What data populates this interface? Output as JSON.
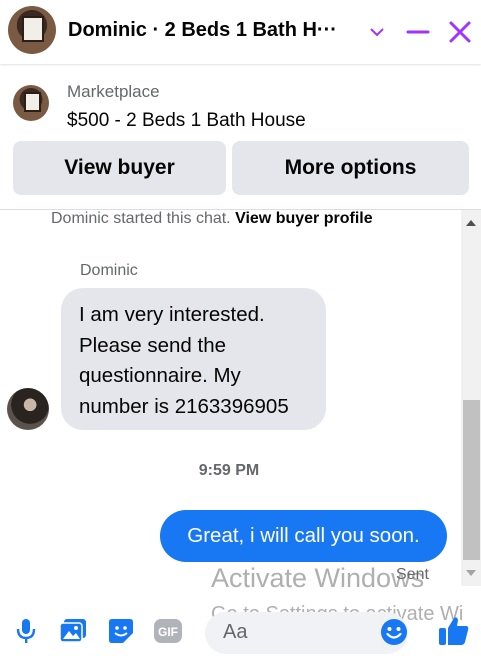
{
  "header": {
    "title": "Dominic · 2 Beds 1 Bath H···",
    "accent_color": "#a033ff",
    "icons": [
      "chevron-down-icon",
      "minimize-icon",
      "close-icon"
    ]
  },
  "marketplace": {
    "label": "Marketplace",
    "listing": "$500 - 2 Beds 1 Bath House"
  },
  "actions": {
    "view_buyer": "View buyer",
    "more_options": "More options"
  },
  "chat": {
    "system_text": "Dominic started this chat.",
    "system_link": "View buyer profile",
    "sender_name": "Dominic",
    "incoming_message": "I am very interested. Please send the questionnaire. My number is 2163396905",
    "timestamp": "9:59 PM",
    "outgoing_message": "Great, i will call you soon.",
    "status": "Sent",
    "bubble_color_in": "#e4e6eb",
    "bubble_color_out": "#1877f2"
  },
  "composer": {
    "placeholder": "Aa",
    "gif_label": "GIF",
    "icons": [
      "microphone-icon",
      "photo-icon",
      "sticker-icon",
      "gif-icon",
      "emoji-icon",
      "thumbs-up-icon"
    ],
    "icon_color": "#1877f2"
  },
  "watermark": {
    "line1": "Activate Windows",
    "line2": "Go to Settings to activate Wi"
  }
}
